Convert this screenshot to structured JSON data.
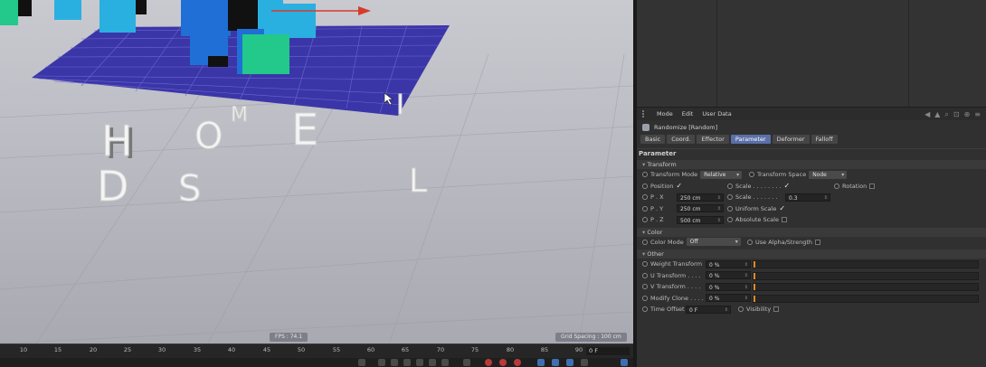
{
  "viewport": {
    "fps_label": "FPS : 74.1",
    "grid_spacing_label": "Grid Spacing : 100 cm",
    "letters": [
      "H",
      "O",
      "M",
      "E",
      "D",
      "S",
      "L",
      "I"
    ]
  },
  "attributes": {
    "menu": [
      "Mode",
      "Edit",
      "User Data"
    ],
    "object_title": "Randomize [Random]",
    "tabs": [
      "Basic",
      "Coord.",
      "Effector",
      "Parameter",
      "Deformer",
      "Falloff"
    ],
    "active_tab": "Parameter",
    "section_title": "Parameter",
    "transform": {
      "group_label": "Transform",
      "mode_label": "Transform Mode",
      "mode_value": "Relative",
      "space_label": "Transform Space",
      "space_value": "Node",
      "position_label": "Position",
      "scale_label": "Scale . . . . . . . .",
      "rotation_label": "Rotation",
      "px_label": "P . X",
      "px_value": "250 cm",
      "py_label": "P . Y",
      "py_value": "250 cm",
      "pz_label": "P . Z",
      "pz_value": "500 cm",
      "scale_value_label": "Scale . . . . . . .",
      "scale_value": "0.3",
      "uniform_scale_label": "Uniform Scale",
      "absolute_scale_label": "Absolute Scale"
    },
    "color": {
      "group_label": "Color",
      "mode_label": "Color Mode",
      "mode_value": "Off",
      "alpha_label": "Use Alpha/Strength"
    },
    "other": {
      "group_label": "Other",
      "weight_label": "Weight Transform",
      "weight_value": "0 %",
      "u_label": "U Transform . . . .",
      "u_value": "0 %",
      "v_label": "V Transform . . . .",
      "v_value": "0 %",
      "modify_label": "Modify Clone . . . .",
      "modify_value": "0 %",
      "time_offset_label": "Time Offset",
      "time_offset_value": "0 F",
      "visibility_label": "Visibility"
    }
  },
  "timeline": {
    "ticks": [
      "10",
      "15",
      "20",
      "25",
      "30",
      "35",
      "40",
      "45",
      "50",
      "55",
      "60",
      "65",
      "70",
      "75",
      "80",
      "85",
      "90"
    ],
    "current_frame": "0 F"
  },
  "colors": {
    "grid_plane": "#3b36a8",
    "cube_blue": "#1f6fd6",
    "cube_cyan": "#2ab0e0",
    "cube_green": "#22c98a",
    "accent_tab": "#5b6fa8",
    "slider_knob": "#e08a2a"
  }
}
